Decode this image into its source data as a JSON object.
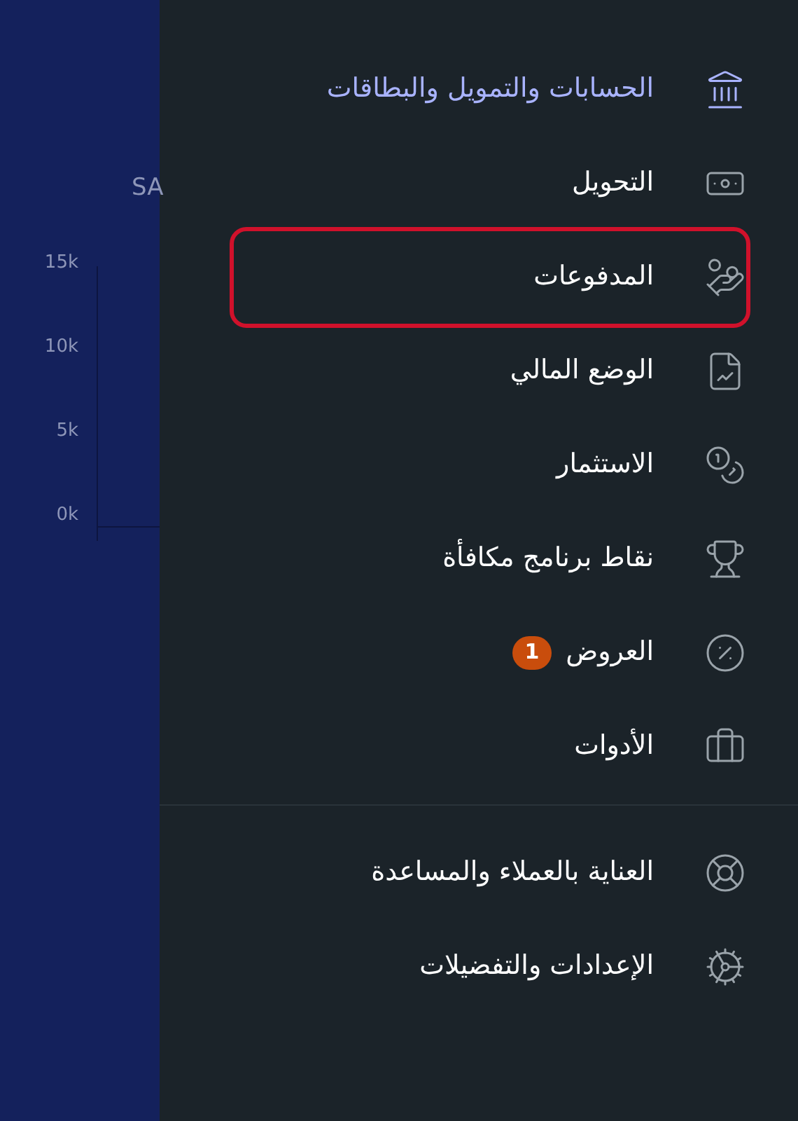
{
  "background": {
    "title": "SA",
    "y_ticks": [
      "15k",
      "10k",
      "5k",
      "0k"
    ]
  },
  "menu": {
    "sections": [
      {
        "items": [
          {
            "label": "الحسابات والتمويل والبطاقات",
            "selected": true,
            "highlighted": false
          },
          {
            "label": "التحويل",
            "selected": false,
            "highlighted": false
          },
          {
            "label": "المدفوعات",
            "selected": false,
            "highlighted": true
          },
          {
            "label": "الوضع المالي",
            "selected": false,
            "highlighted": false
          },
          {
            "label": "الاستثمار",
            "selected": false,
            "highlighted": false
          },
          {
            "label": "نقاط برنامج مكافأة",
            "selected": false,
            "highlighted": false
          },
          {
            "label": "العروض",
            "selected": false,
            "highlighted": false,
            "badge": "1"
          },
          {
            "label": "الأدوات",
            "selected": false,
            "highlighted": false
          }
        ]
      },
      {
        "items": [
          {
            "label": "العناية بالعملاء والمساعدة",
            "selected": false,
            "highlighted": false
          },
          {
            "label": "الإعدادات والتفضيلات",
            "selected": false,
            "highlighted": false
          }
        ]
      }
    ]
  }
}
